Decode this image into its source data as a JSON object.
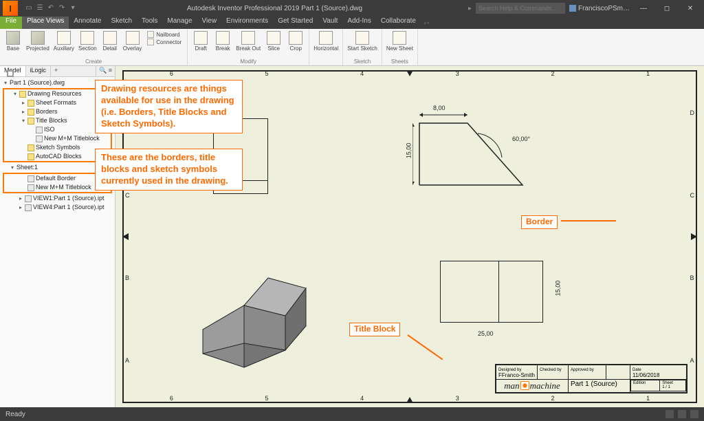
{
  "app": {
    "title": "Autodesk Inventor Professional 2019   Part 1 (Source).dwg",
    "search_placeholder": "Search Help & Commands…",
    "user": "FranciscoPSm…"
  },
  "menu": {
    "file": "File",
    "tabs": [
      "Place Views",
      "Annotate",
      "Sketch",
      "Tools",
      "Manage",
      "View",
      "Environments",
      "Get Started",
      "Vault",
      "Add-Ins",
      "Collaborate"
    ]
  },
  "ribbon": {
    "create": {
      "label": "Create",
      "buttons": [
        "Base",
        "Projected",
        "Auxiliary",
        "Section",
        "Detail",
        "Overlay"
      ],
      "side": [
        "Nailboard",
        "Connector"
      ]
    },
    "modify": {
      "label": "Modify",
      "buttons": [
        "Draft",
        "Break",
        "Break Out",
        "Slice",
        "Crop"
      ]
    },
    "other": [
      {
        "label": "Horizontal"
      },
      {
        "label": "Start Sketch",
        "sub": "Sketch"
      },
      {
        "label": "New Sheet",
        "sub": "Sheets"
      }
    ]
  },
  "browser": {
    "tabs": {
      "model": "Model",
      "ilogic": "iLogic"
    },
    "root": "Part 1 (Source).dwg",
    "drawing_resources": "Drawing Resources",
    "dr_children": {
      "sheet_formats": "Sheet Formats",
      "borders": "Borders",
      "title_blocks": "Title Blocks",
      "tb_children": {
        "iso": "ISO",
        "new": "New M+M Titleblock"
      },
      "sketch_symbols": "Sketch Symbols",
      "autocad_blocks": "AutoCAD Blocks"
    },
    "sheet1": "Sheet:1",
    "sheet_children": {
      "border": "Default Border",
      "tb": "New M+M Titleblock",
      "v1": "VIEW1:Part 1 (Source).ipt",
      "v4": "VIEW4:Part 1 (Source).ipt"
    }
  },
  "drawing": {
    "top_marks": [
      "6",
      "5",
      "4",
      "3",
      "2",
      "1"
    ],
    "side_marks": [
      "D",
      "C",
      "B",
      "A"
    ],
    "dims": {
      "w": "8,00",
      "h": "15,00",
      "angle": "60,00°",
      "w2": "25,00",
      "h2": "15,00"
    }
  },
  "titleblock": {
    "designed_by": "Designed by",
    "checked_by": "Checked by",
    "approved_by": "Approved by",
    "date": "Date",
    "edition": "Edition",
    "sheet": "Sheet",
    "designed_val": "FFranco-Smith",
    "date_val": "11/06/2018",
    "part": "Part 1 (Source)",
    "edition_val": "",
    "sheet_val": "1 / 1",
    "logo1": "man",
    "logo2": "machine"
  },
  "annotations": {
    "res": "Drawing resources are things available for use in the drawing (i.e. Borders, Title Blocks and Sketch Symbols).",
    "used": "These are the borders, title blocks and sketch symbols currently used in the drawing.",
    "border": "Border",
    "tb": "Title Block"
  },
  "status": {
    "ready": "Ready"
  }
}
